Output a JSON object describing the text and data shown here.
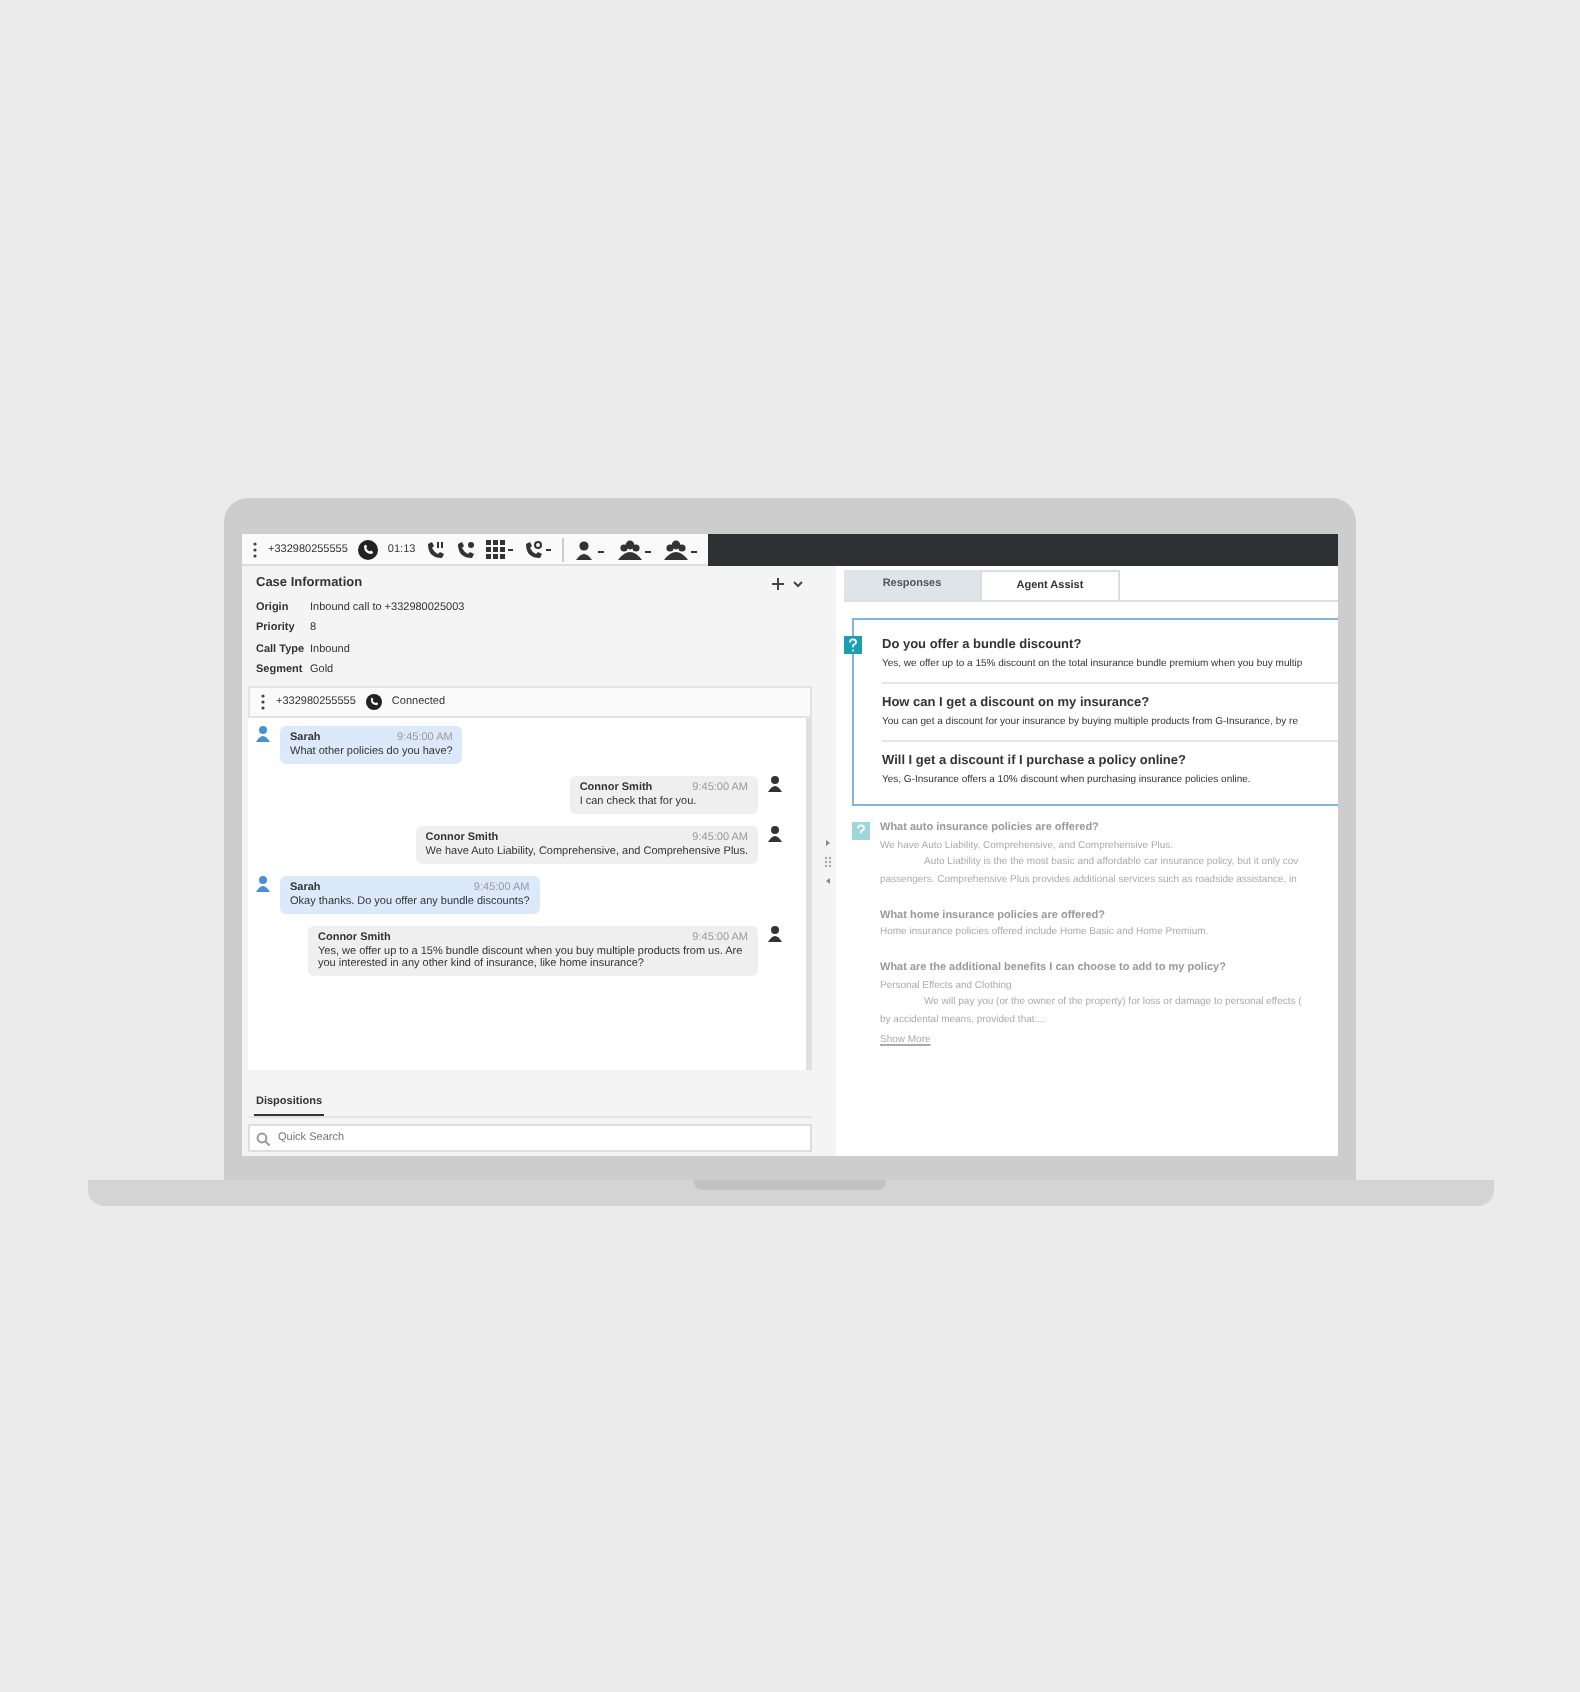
{
  "toolbar": {
    "phone": "+332980255555",
    "timer": "01:13"
  },
  "case_info": {
    "title": "Case Information",
    "fields": [
      {
        "label": "Origin",
        "value": "Inbound call to +332980025003"
      },
      {
        "label": "Priority",
        "value": "8"
      },
      {
        "label": "Call Type",
        "value": "Inbound"
      },
      {
        "label": "Segment",
        "value": "Gold"
      }
    ]
  },
  "call_bar": {
    "phone": "+332980255555",
    "status": "Connected"
  },
  "messages": [
    {
      "kind": "customer",
      "sender": "Sarah",
      "time": "9:45:00 AM",
      "text": "What other policies do you have?"
    },
    {
      "kind": "agent",
      "sender": "Connor Smith",
      "time": "9:45:00 AM",
      "text": "I can check that for you."
    },
    {
      "kind": "agent",
      "sender": "Connor Smith",
      "time": "9:45:00 AM",
      "text": "We have Auto Liability, Comprehensive, and Comprehensive Plus."
    },
    {
      "kind": "customer",
      "sender": "Sarah",
      "time": "9:45:00 AM",
      "text": "Okay thanks. Do you offer any bundle discounts?"
    },
    {
      "kind": "agent",
      "sender": "Connor Smith",
      "time": "9:45:00 AM",
      "text": "Yes, we offer up to a 15% bundle discount when you buy multiple products from us. Are you interested in any other kind of insurance, like home insurance?"
    }
  ],
  "dispositions": {
    "tab": "Dispositions",
    "search_placeholder": "Quick Search"
  },
  "tabs": [
    {
      "label": "Responses",
      "selected": false
    },
    {
      "label": "Agent Assist",
      "selected": true
    }
  ],
  "suggestions": [
    {
      "question": "Do you offer a bundle discount?",
      "answer": "Yes, we offer up to a 15% discount on the total insurance bundle premium when you buy multip"
    },
    {
      "question": "How can I get a discount on my insurance?",
      "answer": "You can get a discount for your insurance by buying multiple products from G-Insurance, by re"
    },
    {
      "question": "Will I get a discount if I purchase a policy online?",
      "answer": "Yes, G-Insurance offers a 10% discount when purchasing insurance policies online."
    }
  ],
  "results": [
    {
      "question": "What auto insurance policies are offered?",
      "lines": [
        {
          "text": "We have Auto Liability, Comprehensive, and Comprehensive Plus.",
          "indent": false
        },
        {
          "text": "Auto Liability is the the most basic and affordable car insurance policy, but it only cov",
          "indent": true
        },
        {
          "text": "passengers. Comprehensive Plus provides additional services such as roadside assistance, in",
          "indent": false
        }
      ]
    },
    {
      "question": "What home insurance policies are offered?",
      "lines": [
        {
          "text": "Home insurance policies offered include Home Basic and Home Premium.",
          "indent": false
        }
      ]
    },
    {
      "question": "What are the additional benefits I can choose to add to my policy?",
      "lines": [
        {
          "text": "Personal Effects and Clothing",
          "indent": false
        },
        {
          "text": "We will pay you (or the owner of the property) for loss or damage to personal effects (",
          "indent": true
        },
        {
          "text": "by accidental means, provided that:...",
          "indent": false
        }
      ]
    }
  ],
  "show_more": "Show More"
}
